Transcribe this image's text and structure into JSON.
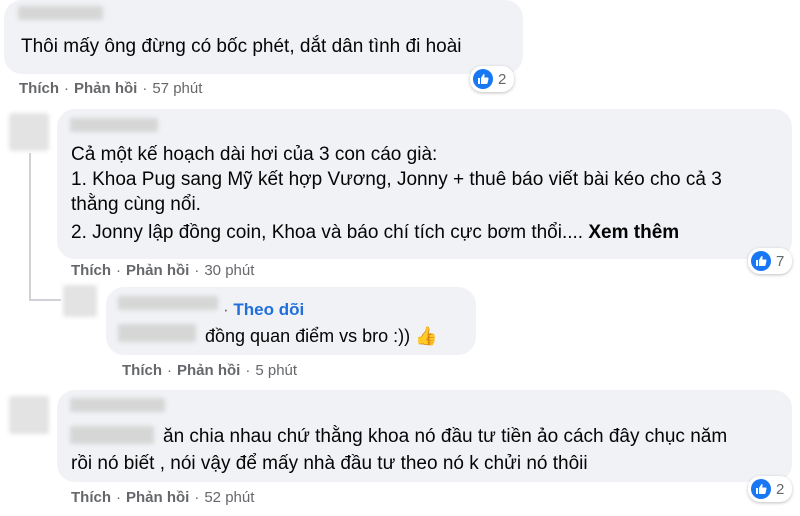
{
  "comments": [
    {
      "lines": [
        "Thôi mấy ông đừng có bốc phét, dắt dân tình đi hoài"
      ],
      "actions": {
        "like": "Thích",
        "reply": "Phản hồi",
        "time": "57 phút"
      },
      "reactions": {
        "icon": "like-icon",
        "count": "2"
      }
    },
    {
      "lines": [
        "Cả một kế hoạch dài hơi của 3 con cáo già:",
        "1. Khoa Pug sang Mỹ kết hợp Vương, Jonny + thuê báo viết bài kéo cho cả 3",
        "thằng cùng nổi.",
        "2. Jonny lập đồng coin, Khoa và báo chí tích cực bơm thổi...."
      ],
      "see_more": "Xem thêm",
      "actions": {
        "like": "Thích",
        "reply": "Phản hồi",
        "time": "30 phút"
      },
      "reactions": {
        "icon": "like-icon",
        "count": "7"
      },
      "reply": {
        "follow_label": "Theo dõi",
        "separator": "·",
        "text": "đồng quan điểm vs bro :))",
        "emoji": "👍",
        "actions": {
          "like": "Thích",
          "reply": "Phản hồi",
          "time": "5 phút"
        }
      }
    },
    {
      "lines": [
        "ăn chia nhau chứ thằng khoa nó đầu tư tiền ảo cách đây chục năm",
        "rồi nó biết , nói vậy để mấy nhà đầu tư theo nó k chửi nó thôii"
      ],
      "actions": {
        "like": "Thích",
        "reply": "Phản hồi",
        "time": "52 phút"
      },
      "reactions": {
        "icon": "like-icon",
        "count": "2"
      }
    }
  ],
  "colors": {
    "bubble": "#f0f2f5",
    "meta": "#65676b",
    "link": "#216fdb",
    "like": "#1877f2"
  }
}
